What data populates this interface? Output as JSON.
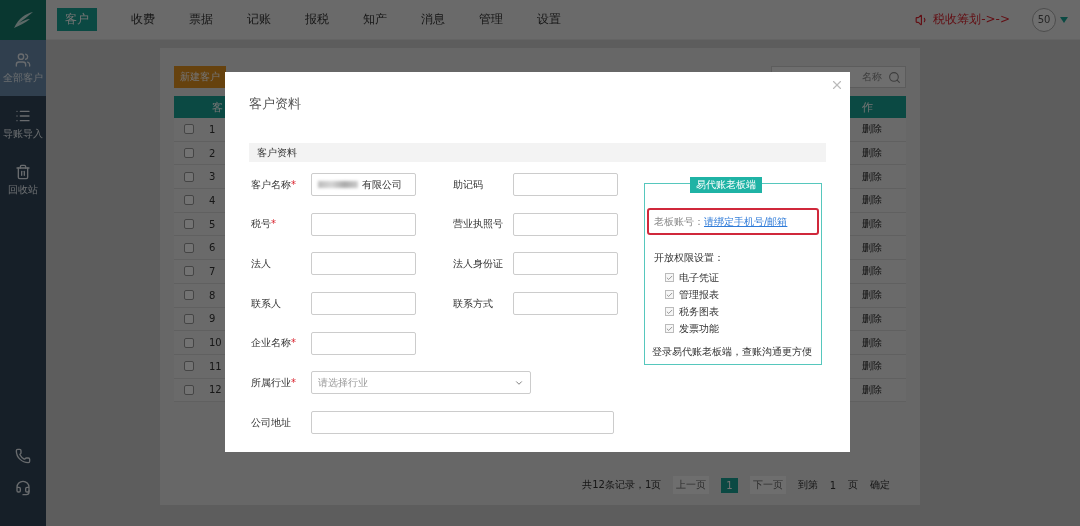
{
  "sidebar": {
    "items": [
      {
        "label": "全部客户",
        "selected": true
      },
      {
        "label": "导账导入",
        "selected": false
      },
      {
        "label": "回收站",
        "selected": false
      }
    ]
  },
  "nav": {
    "tabs": [
      {
        "label": "客户",
        "selected": true
      },
      {
        "label": "收费",
        "selected": false
      },
      {
        "label": "票据",
        "selected": false
      },
      {
        "label": "记账",
        "selected": false
      },
      {
        "label": "报税",
        "selected": false
      },
      {
        "label": "知产",
        "selected": false
      },
      {
        "label": "消息",
        "selected": false
      },
      {
        "label": "管理",
        "selected": false
      },
      {
        "label": "设置",
        "selected": false
      }
    ],
    "promo": "税收筹划->->",
    "avatar": "50"
  },
  "toolbar": {
    "new_button": "新建客户",
    "search_placeholder": "名称"
  },
  "table": {
    "columns": [
      "客",
      "作"
    ],
    "rows": [
      {
        "no": "1",
        "checked": false,
        "action": "删除"
      },
      {
        "no": "2",
        "checked": false,
        "action": "删除"
      },
      {
        "no": "3",
        "checked": false,
        "action": "删除"
      },
      {
        "no": "4",
        "checked": false,
        "action": "删除"
      },
      {
        "no": "5",
        "checked": false,
        "action": "删除"
      },
      {
        "no": "6",
        "checked": false,
        "action": "删除"
      },
      {
        "no": "7",
        "checked": false,
        "action": "删除"
      },
      {
        "no": "8",
        "checked": false,
        "action": "删除"
      },
      {
        "no": "9",
        "checked": false,
        "action": "删除"
      },
      {
        "no": "10",
        "checked": false,
        "action": "删除"
      },
      {
        "no": "11",
        "checked": false,
        "action": "删除"
      },
      {
        "no": "12",
        "checked": false,
        "action": "删除"
      }
    ]
  },
  "pagination": {
    "summary": "共12条记录，1页",
    "prev": {
      "label": "上一页",
      "disabled": true
    },
    "pages": [
      {
        "label": "1",
        "selected": true
      }
    ],
    "next": {
      "label": "下一页",
      "disabled": true
    },
    "goto_label": "到第",
    "goto_value": "1",
    "page_unit": "页",
    "confirm": "确定"
  },
  "modal": {
    "title": "客户资料",
    "section": "客户资料",
    "rows": [
      [
        {
          "label": "客户名称",
          "mark": "*",
          "kind": "input",
          "value": "有限公司",
          "blurred": true
        },
        {
          "label": "助记码",
          "kind": "input"
        }
      ],
      [
        {
          "label": "税号",
          "mark": "*",
          "kind": "input"
        },
        {
          "label": "营业执照号",
          "kind": "input"
        }
      ],
      [
        {
          "label": "法人",
          "kind": "input"
        },
        {
          "label": "法人身份证",
          "kind": "input"
        }
      ],
      [
        {
          "label": "联系人",
          "kind": "input"
        },
        {
          "label": "联系方式",
          "kind": "input"
        }
      ],
      [
        {
          "label": "企业名称",
          "mark": "*",
          "kind": "input"
        }
      ],
      [
        {
          "label": "所属行业",
          "mark": "*",
          "kind": "select",
          "placeholder": "请选择行业"
        }
      ],
      [
        {
          "label": "公司地址",
          "kind": "long-input"
        }
      ]
    ],
    "boss": {
      "badge": "易代账老板端",
      "account_label": "老板账号：",
      "account_link": "请绑定手机号/邮箱",
      "highlighted": true,
      "perm_title": "开放权限设置：",
      "perms": [
        {
          "label": "电子凭证",
          "checked": true
        },
        {
          "label": "管理报表",
          "checked": true
        },
        {
          "label": "税务图表",
          "checked": true
        },
        {
          "label": "发票功能",
          "checked": true
        }
      ],
      "footer": "登录易代账老板端，查账沟通更方便"
    }
  }
}
